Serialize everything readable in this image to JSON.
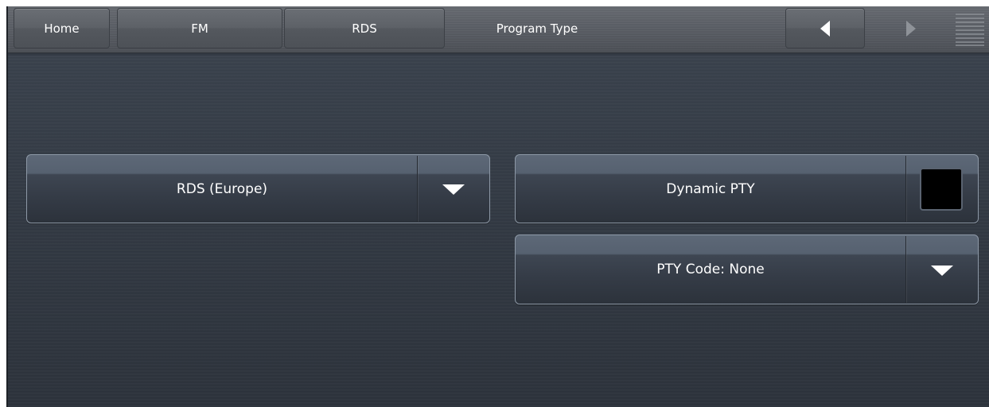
{
  "nav": {
    "home_label": "Home",
    "fm_label": "FM",
    "rds_label": "RDS",
    "title": "Program Type"
  },
  "controls": {
    "rds_mode": {
      "label": "RDS (Europe)"
    },
    "dynamic_pty": {
      "label": "Dynamic PTY",
      "checked": false
    },
    "pty_code": {
      "label": "PTY Code: None"
    }
  },
  "icons": {
    "back": "triangle-left-icon",
    "forward": "triangle-right-icon",
    "menu": "menu-lines-icon",
    "dropdown": "chevron-down-icon"
  }
}
